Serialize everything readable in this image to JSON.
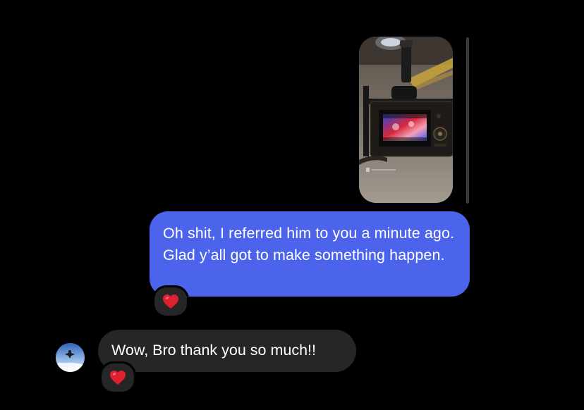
{
  "thread": {
    "messages": [
      {
        "direction": "outgoing",
        "type": "image",
        "image_description": "camera-monitor-photo"
      },
      {
        "direction": "outgoing",
        "type": "text",
        "text": "Oh shit, I referred him to you a minute ago. Glad y’all got to make something happen.",
        "reaction": "❤️"
      },
      {
        "direction": "incoming",
        "type": "text",
        "text": "Wow, Bro thank you so much!!",
        "reaction": "❤️"
      }
    ]
  },
  "colors": {
    "background": "#000000",
    "outgoing_bubble": "#4c63eb",
    "incoming_bubble": "#262626",
    "reaction_heart": "#e0202e"
  }
}
